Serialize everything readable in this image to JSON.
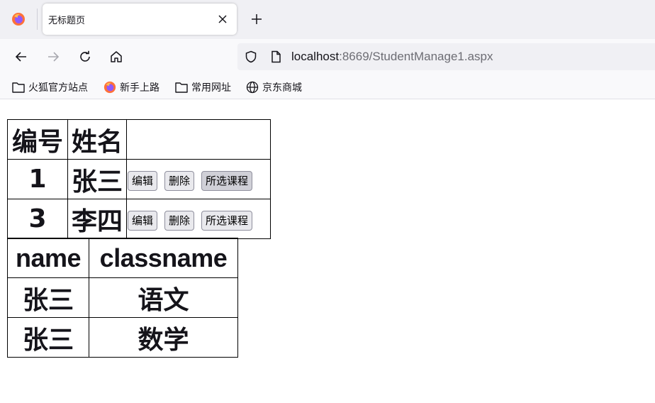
{
  "browser": {
    "tab": {
      "title": "无标题页"
    },
    "url": {
      "host": "localhost",
      "rest": ":8669/StudentManage1.aspx"
    },
    "bookmarks": [
      {
        "label": "火狐官方站点",
        "icon": "folder-icon"
      },
      {
        "label": "新手上路",
        "icon": "firefox-icon"
      },
      {
        "label": "常用网址",
        "icon": "folder-icon"
      },
      {
        "label": "京东商城",
        "icon": "globe-icon"
      }
    ]
  },
  "students": {
    "headers": {
      "id": "编号",
      "name": "姓名",
      "actions": ""
    },
    "rows": [
      {
        "id": "1",
        "name": "张三",
        "edit": "编辑",
        "delete": "删除",
        "courses": "所选课程"
      },
      {
        "id": "3",
        "name": "李四",
        "edit": "编辑",
        "delete": "删除",
        "courses": "所选课程"
      }
    ]
  },
  "courses": {
    "headers": {
      "name": "name",
      "classname": "classname"
    },
    "rows": [
      {
        "name": "张三",
        "classname": "语文"
      },
      {
        "name": "张三",
        "classname": "数学"
      }
    ]
  },
  "colors": {
    "tabstrip": "#f0f0f4",
    "toolbar": "#f9f9fb",
    "urlbar": "#f0f0f4",
    "button": "#e9e9ed"
  }
}
